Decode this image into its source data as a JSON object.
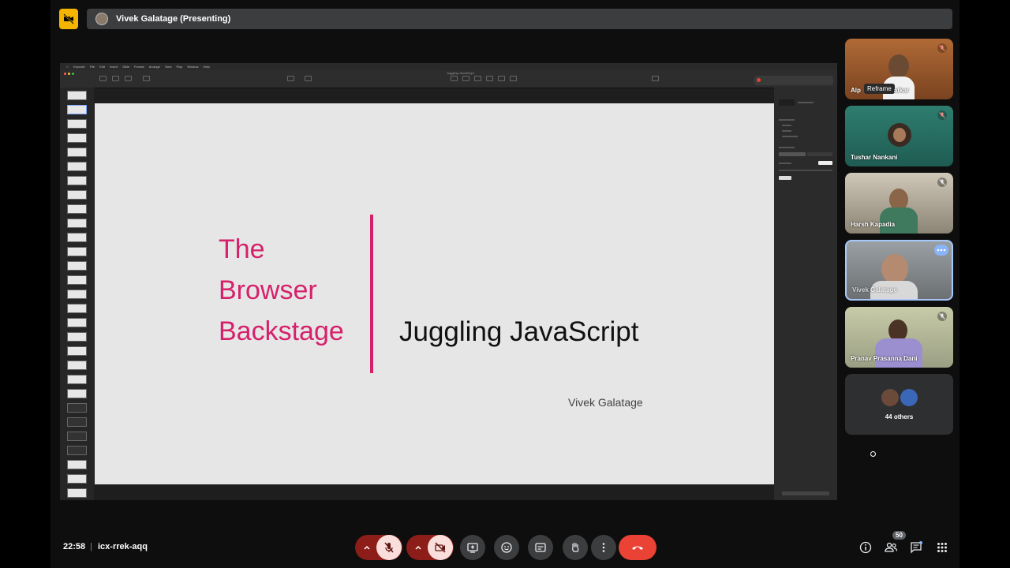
{
  "top_bar": {
    "presenter_label": "Vivek Galatage (Presenting)"
  },
  "shared_screen": {
    "menu_bar": [
      "Keynote",
      "File",
      "Edit",
      "Insert",
      "Slide",
      "Format",
      "Arrange",
      "View",
      "Play",
      "Window",
      "Help"
    ],
    "document_title": "Juggling JavaScript",
    "slide": {
      "left_lines": [
        "The",
        "Browser",
        "Backstage"
      ],
      "title": "Juggling JavaScript",
      "author": "Vivek Galatage"
    }
  },
  "participants": [
    {
      "name": "Alp",
      "name_suffix": "atkar",
      "overlay": "Reframe",
      "muted": true
    },
    {
      "name": "Tushar Nankani",
      "muted": true
    },
    {
      "name": "Harsh Kapadia",
      "muted": true
    },
    {
      "name": "Vivek Galatage",
      "muted": false,
      "active": true
    },
    {
      "name": "Pranav Prasanna Dani",
      "muted": true
    }
  ],
  "others": {
    "label": "44 others"
  },
  "bottom_bar": {
    "time": "22:58",
    "separator": "|",
    "meeting_code": "icx-rrek-aqq",
    "participants_count": "50"
  },
  "icons": {
    "camera_off_badge": "video-off-icon",
    "mic": "mic-off-icon",
    "camera": "video-off-icon",
    "present": "present-screen-icon",
    "emoji": "emoji-icon",
    "captions": "captions-icon",
    "hand": "raise-hand-icon",
    "more": "more-vert-icon",
    "end_call": "end-call-icon",
    "info": "info-icon",
    "people": "people-icon",
    "chat": "chat-icon",
    "activities": "apps-icon"
  },
  "colors": {
    "accent_slide": "#d6206b",
    "end_call": "#ea4335",
    "mic_cam_off_bg": "#f9dedc",
    "presenter_badge": "#f4b400",
    "active_tile_border": "#a8c7fa"
  }
}
